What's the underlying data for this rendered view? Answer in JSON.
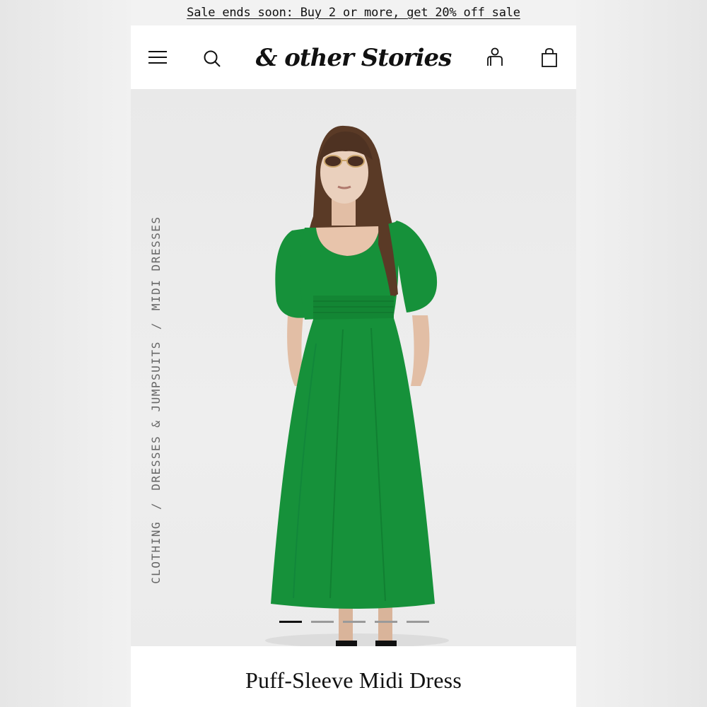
{
  "promo": {
    "text": "Sale ends soon: Buy 2 or more, get 20% off sale"
  },
  "header": {
    "logo_text": "& other Stories",
    "icons": [
      "menu-icon",
      "search-icon",
      "account-icon",
      "bag-icon"
    ]
  },
  "breadcrumb": {
    "items": [
      "CLOTHING",
      "DRESSES & JUMPSUITS",
      "MIDI DRESSES"
    ],
    "separator": "/"
  },
  "gallery": {
    "image_count": 5,
    "active_index": 0,
    "dress_color": "#16913a"
  },
  "product": {
    "title": "Puff-Sleeve Midi Dress"
  },
  "colors": {
    "text": "#111111",
    "promo_bg": "#f2f2f2",
    "gallery_bg": "#ebebeb"
  }
}
